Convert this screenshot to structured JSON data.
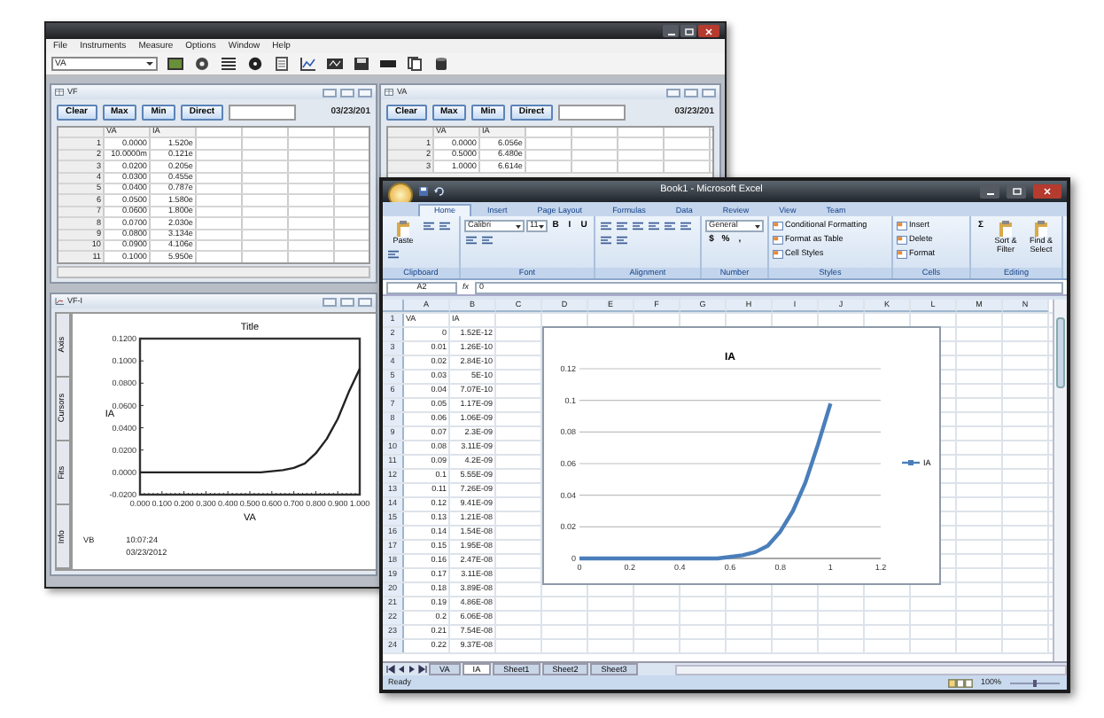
{
  "instrument_window": {
    "menu": [
      "File",
      "Instruments",
      "Measure",
      "Options",
      "Window",
      "Help"
    ],
    "channel_select": "VA",
    "table_windows": [
      {
        "title": "VF",
        "buttons": [
          "Clear",
          "Max",
          "Min",
          "Direct"
        ],
        "date": "03/23/201",
        "columns": [
          "VA",
          "IA"
        ],
        "rows": [
          [
            "1",
            "0.0000",
            "1.520e"
          ],
          [
            "2",
            "10.0000m",
            "0.121e"
          ],
          [
            "3",
            "0.0200",
            "0.205e"
          ],
          [
            "4",
            "0.0300",
            "0.455e"
          ],
          [
            "5",
            "0.0400",
            "0.787e"
          ],
          [
            "6",
            "0.0500",
            "1.580e"
          ],
          [
            "7",
            "0.0600",
            "1.800e"
          ],
          [
            "8",
            "0.0700",
            "2.030e"
          ],
          [
            "9",
            "0.0800",
            "3.134e"
          ],
          [
            "10",
            "0.0900",
            "4.106e"
          ],
          [
            "11",
            "0.1000",
            "5.950e"
          ]
        ]
      },
      {
        "title": "VA",
        "buttons": [
          "Clear",
          "Max",
          "Min",
          "Direct"
        ],
        "date": "03/23/201",
        "columns": [
          "VA",
          "IA"
        ],
        "rows": [
          [
            "1",
            "0.0000",
            "6.056e"
          ],
          [
            "2",
            "0.5000",
            "6.480e"
          ],
          [
            "3",
            "1.0000",
            "6.614e"
          ]
        ]
      }
    ],
    "graph_window": {
      "title": "VF-I",
      "side_tabs": [
        "Axis",
        "Cursors",
        "Fits",
        "Info"
      ],
      "chart_data": {
        "type": "line",
        "title": "Title",
        "xlabel": "VA",
        "ylabel": "IA",
        "x": [
          0,
          0.05,
          0.1,
          0.15,
          0.2,
          0.25,
          0.3,
          0.35,
          0.4,
          0.45,
          0.5,
          0.55,
          0.6,
          0.65,
          0.7,
          0.75,
          0.8,
          0.85,
          0.9,
          0.95,
          1
        ],
        "series": [
          {
            "color": "#222222",
            "values": [
              0,
              0,
              0,
              0,
              0,
              0,
              0,
              0,
              0,
              0,
              0,
              0,
              0.001,
              0.002,
              0.004,
              0.008,
              0.017,
              0.03,
              0.048,
              0.072,
              0.093
            ]
          }
        ],
        "xlim": [
          0,
          1
        ],
        "ylim": [
          -0.02,
          0.12
        ],
        "xticks": [
          {
            "value": 0,
            "label": "0.000"
          },
          {
            "value": 0.1,
            "label": "0.100"
          },
          {
            "value": 0.2,
            "label": "0.200"
          },
          {
            "value": 0.3,
            "label": "0.300"
          },
          {
            "value": 0.4,
            "label": "0.400"
          },
          {
            "value": 0.5,
            "label": "0.500"
          },
          {
            "value": 0.6,
            "label": "0.600"
          },
          {
            "value": 0.7,
            "label": "0.700"
          },
          {
            "value": 0.8,
            "label": "0.800"
          },
          {
            "value": 0.9,
            "label": "0.900"
          },
          {
            "value": 1,
            "label": "1.000"
          }
        ],
        "yticks": [
          {
            "value": 0.12,
            "label": "0.1200"
          },
          {
            "value": 0.1,
            "label": "0.1000"
          },
          {
            "value": 0.08,
            "label": "0.0800"
          },
          {
            "value": 0.06,
            "label": "0.0600"
          },
          {
            "value": 0.04,
            "label": "0.0400"
          },
          {
            "value": 0.02,
            "label": "0.0200"
          },
          {
            "value": 0,
            "label": "0.0000"
          },
          {
            "value": -0.02,
            "label": "-0.0200"
          }
        ]
      },
      "footer": {
        "channel": "VB",
        "time": "10:07:24",
        "date": "03/23/2012"
      }
    }
  },
  "excel_window": {
    "title": "Book1 - Microsoft Excel",
    "tabs": [
      {
        "label": "Home",
        "selected": true
      },
      {
        "label": "Insert",
        "selected": false
      },
      {
        "label": "Page Layout",
        "selected": false
      },
      {
        "label": "Formulas",
        "selected": false
      },
      {
        "label": "Data",
        "selected": false
      },
      {
        "label": "Review",
        "selected": false
      },
      {
        "label": "View",
        "selected": false
      },
      {
        "label": "Team",
        "selected": false
      }
    ],
    "ribbon_groups": [
      {
        "label": "Clipboard",
        "controls": [
          {
            "kind": "big",
            "label": "Paste"
          },
          {
            "kind": "lines"
          },
          {
            "kind": "lines"
          },
          {
            "kind": "lines"
          }
        ]
      },
      {
        "label": "Font",
        "controls": [
          {
            "kind": "combo",
            "label": "Calibri"
          },
          {
            "kind": "combo",
            "label": "11"
          },
          {
            "kind": "glyph",
            "label": "B"
          },
          {
            "kind": "glyph",
            "label": "I"
          },
          {
            "kind": "glyph",
            "label": "U"
          },
          {
            "kind": "lines"
          },
          {
            "kind": "lines"
          }
        ]
      },
      {
        "label": "Alignment",
        "controls": [
          {
            "kind": "lines"
          },
          {
            "kind": "lines"
          },
          {
            "kind": "lines"
          },
          {
            "kind": "lines"
          },
          {
            "kind": "lines"
          },
          {
            "kind": "lines"
          },
          {
            "kind": "lines"
          },
          {
            "kind": "lines"
          }
        ]
      },
      {
        "label": "Number",
        "controls": [
          {
            "kind": "combo",
            "label": "General"
          },
          {
            "kind": "glyph",
            "label": "$"
          },
          {
            "kind": "glyph",
            "label": "%"
          },
          {
            "kind": "glyph",
            "label": ","
          }
        ]
      },
      {
        "label": "Styles",
        "controls": [
          {
            "kind": "small",
            "label": "Conditional Formatting"
          },
          {
            "kind": "small",
            "label": "Format as Table"
          },
          {
            "kind": "small",
            "label": "Cell Styles"
          }
        ]
      },
      {
        "label": "Cells",
        "controls": [
          {
            "kind": "small",
            "label": "Insert"
          },
          {
            "kind": "small",
            "label": "Delete"
          },
          {
            "kind": "small",
            "label": "Format"
          }
        ]
      },
      {
        "label": "Editing",
        "controls": [
          {
            "kind": "glyph",
            "label": "Σ"
          },
          {
            "kind": "big",
            "label": "Sort & Filter"
          },
          {
            "kind": "big",
            "label": "Find & Select"
          }
        ]
      }
    ],
    "name_box": "A2",
    "formula_label": "fx",
    "formula": "0",
    "columns": [
      "A",
      "B",
      "C",
      "D",
      "E",
      "F",
      "G",
      "H",
      "I",
      "J",
      "K",
      "L",
      "M",
      "N"
    ],
    "rows": [
      {
        "n": "1",
        "cells": [
          "VA",
          "IA"
        ]
      },
      {
        "n": "2",
        "cells": [
          "0",
          "1.52E-12"
        ]
      },
      {
        "n": "3",
        "cells": [
          "0.01",
          "1.26E-10"
        ]
      },
      {
        "n": "4",
        "cells": [
          "0.02",
          "2.84E-10"
        ]
      },
      {
        "n": "5",
        "cells": [
          "0.03",
          "5E-10"
        ]
      },
      {
        "n": "6",
        "cells": [
          "0.04",
          "7.07E-10"
        ]
      },
      {
        "n": "7",
        "cells": [
          "0.05",
          "1.17E-09"
        ]
      },
      {
        "n": "8",
        "cells": [
          "0.06",
          "1.06E-09"
        ]
      },
      {
        "n": "9",
        "cells": [
          "0.07",
          "2.3E-09"
        ]
      },
      {
        "n": "10",
        "cells": [
          "0.08",
          "3.11E-09"
        ]
      },
      {
        "n": "11",
        "cells": [
          "0.09",
          "4.2E-09"
        ]
      },
      {
        "n": "12",
        "cells": [
          "0.1",
          "5.55E-09"
        ]
      },
      {
        "n": "13",
        "cells": [
          "0.11",
          "7.26E-09"
        ]
      },
      {
        "n": "14",
        "cells": [
          "0.12",
          "9.41E-09"
        ]
      },
      {
        "n": "15",
        "cells": [
          "0.13",
          "1.21E-08"
        ]
      },
      {
        "n": "16",
        "cells": [
          "0.14",
          "1.54E-08"
        ]
      },
      {
        "n": "17",
        "cells": [
          "0.15",
          "1.95E-08"
        ]
      },
      {
        "n": "18",
        "cells": [
          "0.16",
          "2.47E-08"
        ]
      },
      {
        "n": "19",
        "cells": [
          "0.17",
          "3.11E-08"
        ]
      },
      {
        "n": "20",
        "cells": [
          "0.18",
          "3.89E-08"
        ]
      },
      {
        "n": "21",
        "cells": [
          "0.19",
          "4.86E-08"
        ]
      },
      {
        "n": "22",
        "cells": [
          "0.2",
          "6.06E-08"
        ]
      },
      {
        "n": "23",
        "cells": [
          "0.21",
          "7.54E-08"
        ]
      },
      {
        "n": "24",
        "cells": [
          "0.22",
          "9.37E-08"
        ]
      }
    ],
    "chart": {
      "chart_data": {
        "type": "line",
        "title": "IA",
        "x": [
          0,
          0.05,
          0.1,
          0.15,
          0.2,
          0.25,
          0.3,
          0.35,
          0.4,
          0.45,
          0.5,
          0.55,
          0.6,
          0.65,
          0.7,
          0.75,
          0.8,
          0.85,
          0.9,
          0.95,
          1
        ],
        "series": [
          {
            "name": "IA",
            "color": "#4a7ebb",
            "values": [
              0,
              0,
              0,
              0,
              0,
              0,
              0,
              0,
              0,
              0,
              0,
              0,
              0.001,
              0.002,
              0.004,
              0.008,
              0.017,
              0.03,
              0.048,
              0.072,
              0.098
            ]
          }
        ],
        "xlim": [
          0,
          1.2
        ],
        "ylim": [
          0,
          0.12
        ],
        "grid": true,
        "xticks": [
          0,
          0.2,
          0.4,
          0.6,
          0.8,
          1,
          1.2
        ],
        "yticks": [
          0,
          0.02,
          0.04,
          0.06,
          0.08,
          0.1,
          0.12
        ]
      }
    },
    "sheet_tabs": [
      {
        "label": "VA",
        "selected": false
      },
      {
        "label": "IA",
        "selected": true
      },
      {
        "label": "Sheet1",
        "selected": false
      },
      {
        "label": "Sheet2",
        "selected": false
      },
      {
        "label": "Sheet3",
        "selected": false
      }
    ],
    "status": "Ready",
    "zoom": "100%"
  }
}
